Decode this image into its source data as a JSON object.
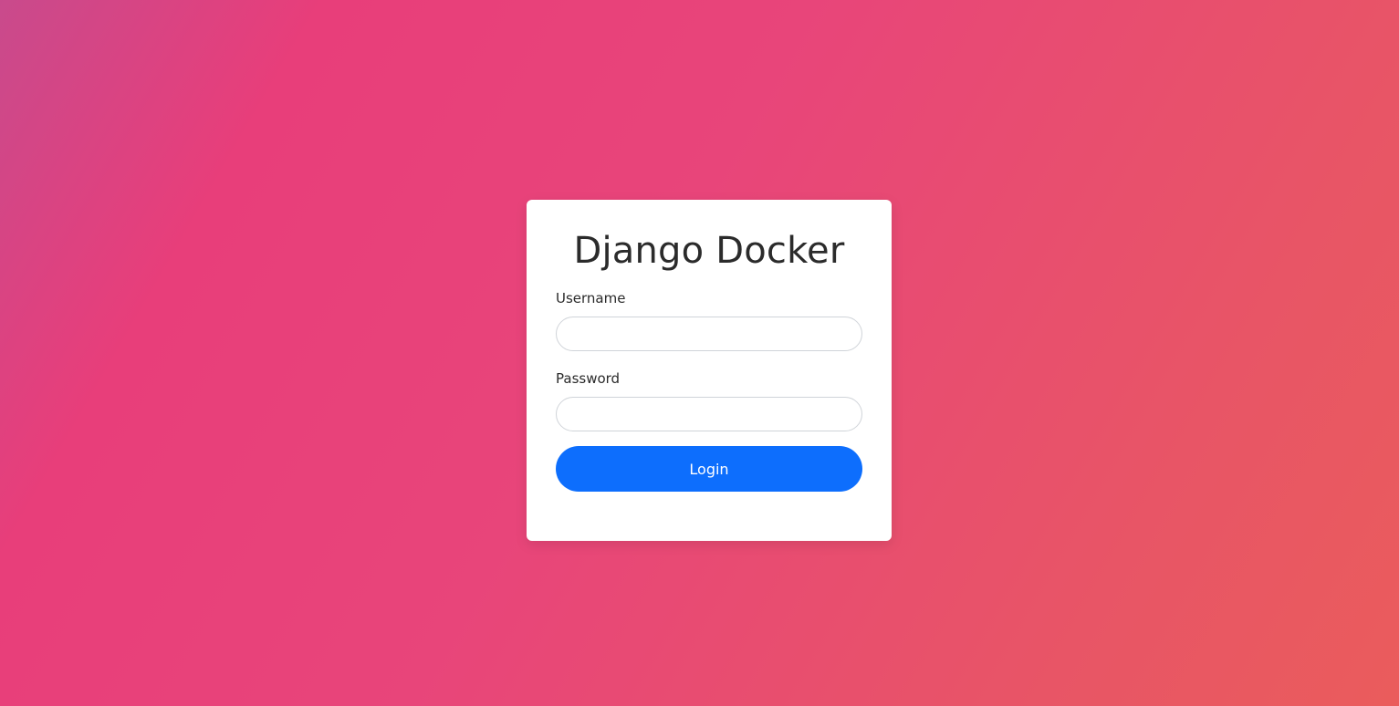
{
  "login": {
    "title": "Django Docker",
    "username_label": "Username",
    "username_value": "",
    "password_label": "Password",
    "password_value": "",
    "submit_label": "Login"
  },
  "colors": {
    "background_start": "#c94a8c",
    "background_mid": "#e8457a",
    "background_end": "#ea5c5c",
    "card": "#ffffff",
    "button": "#0d6efd",
    "text": "#2b2b2b"
  }
}
